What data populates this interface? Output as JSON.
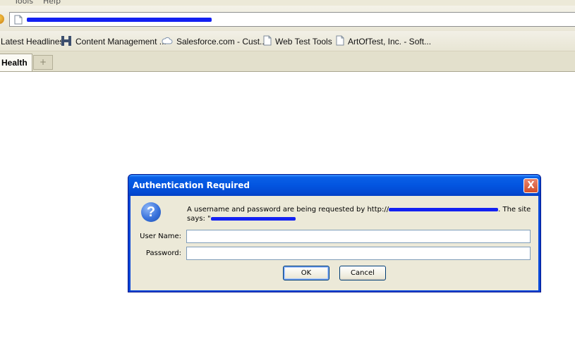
{
  "menu": {
    "items": [
      "Tools",
      "Help"
    ]
  },
  "address_bar": {
    "url_redacted": ""
  },
  "bookmarks": [
    {
      "label": "Latest Headlines",
      "icon": "rss-icon"
    },
    {
      "label": "Content Management ...",
      "icon": "h-icon"
    },
    {
      "label": "Salesforce.com - Cust...",
      "icon": "cloud-icon"
    },
    {
      "label": "Web Test Tools",
      "icon": "page-icon"
    },
    {
      "label": "ArtOfTest, Inc. - Soft...",
      "icon": "page-icon"
    }
  ],
  "tabs": {
    "active_label": "Health",
    "new_tab_glyph": "+"
  },
  "dialog": {
    "title": "Authentication Required",
    "close_glyph": "X",
    "icon_glyph": "?",
    "message_part1": "A username and password are being requested by http://",
    "message_part2": ". The site",
    "message_line2": "says: \"",
    "username_label": "User Name:",
    "username_value": "",
    "password_label": "Password:",
    "password_value": "",
    "ok_label": "OK",
    "cancel_label": "Cancel"
  },
  "colors": {
    "title_bar": "#0355e0",
    "client_bg": "#ece9d8",
    "redaction": "#1321f2",
    "close_button": "#d24e29"
  }
}
